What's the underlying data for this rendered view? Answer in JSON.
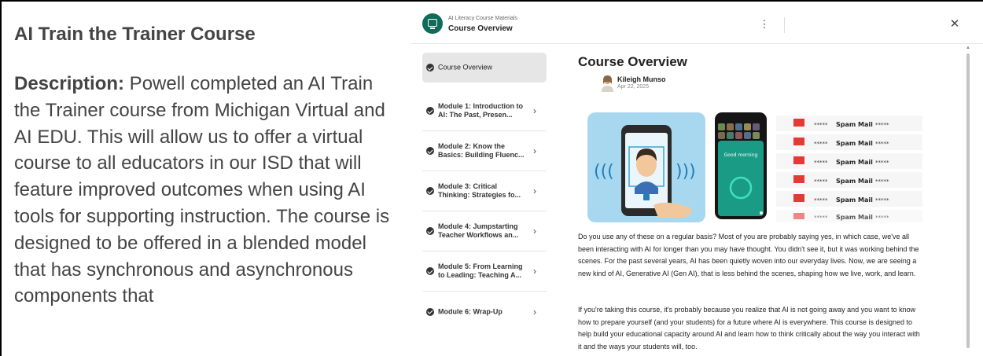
{
  "left": {
    "title": "AI Train the Trainer Course",
    "desc_label": "Description:",
    "desc_text": " Powell completed an AI Train the Trainer course from Michigan Virtual and AI EDU. This will allow us to offer a virtual course to all educators in our ISD that will feature improved outcomes when using AI tools for supporting instruction. The course is designed to be offered in a blended model that has synchronous and asynchronous components that"
  },
  "app": {
    "subtitle": "AI Literacy Course Materials",
    "title": "Course Overview",
    "menu_icon": "more-vertical-icon",
    "close_icon": "close-icon"
  },
  "sidebar": {
    "items": [
      {
        "label": "Course Overview",
        "active": true
      },
      {
        "label": "Module 1: Introduction to AI: The Past, Presen..."
      },
      {
        "label": "Module 2: Know the Basics: Building Fluenc..."
      },
      {
        "label": "Module 3: Critical Thinking: Strategies fo..."
      },
      {
        "label": "Module 4: Jumpstarting Teacher Workflows an..."
      },
      {
        "label": "Module 5: From Learning to Leading: Teaching A..."
      },
      {
        "label": "Module 6: Wrap-Up"
      }
    ]
  },
  "main": {
    "heading": "Course Overview",
    "author": "Kileigh Munso",
    "date": "Apr 22, 2025",
    "hero": {
      "phone_greeting": "Good morning",
      "spam_label": "Spam Mail",
      "spam_stars": "*****"
    },
    "para1": "Do you use any of these on a regular basis? Most of you are probably saying yes, in which case, we've all been interacting with AI for longer than you may have thought. You didn't see it, but it was working behind the scenes. For the past several years, AI has been quietly woven into our everyday lives. Now, we are seeing a new kind of AI, Generative AI (Gen AI), that is less behind the scenes, shaping how we live, work, and learn.",
    "para2": "If you're taking this course, it's probably because you realize that AI is not going away and you want to know how to prepare yourself (and your students) for a future where AI is everywhere. This course is designed to help build your educational capacity around AI and learn how to think critically about the way you interact with it and the ways your students will, too."
  },
  "colors": {
    "brand": "#0f6b5a",
    "text": "#444444",
    "active_bg": "#e6e6e6",
    "mail_red": "#e53935",
    "face_blue": "#a8d8f0"
  }
}
